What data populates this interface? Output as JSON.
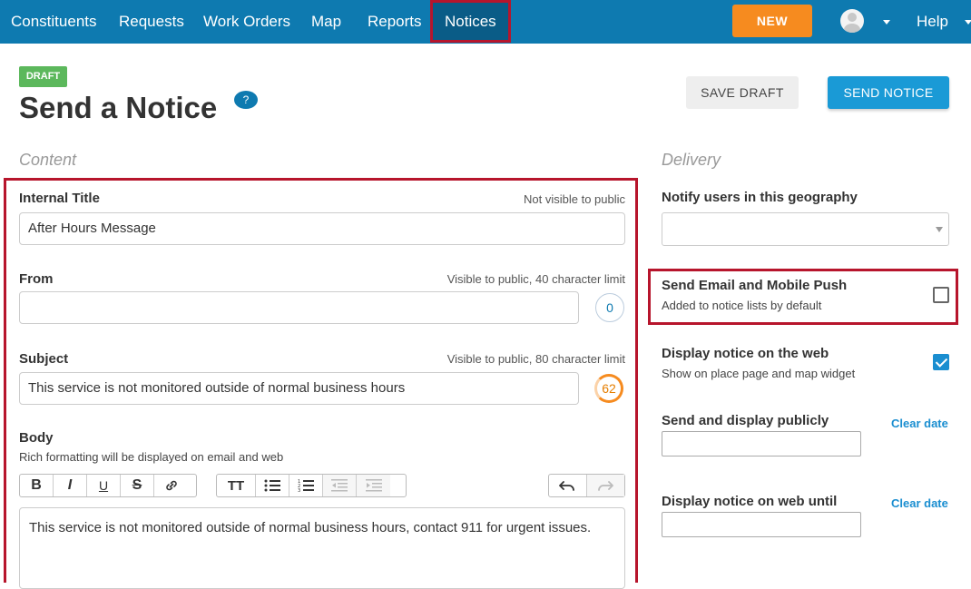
{
  "nav": {
    "items": [
      "Constituents",
      "Requests",
      "Work Orders",
      "Map",
      "Reports",
      "Notices"
    ],
    "new_label": "NEW",
    "help_label": "Help"
  },
  "header": {
    "badge": "DRAFT",
    "title": "Send a Notice",
    "help_icon": "?",
    "save_draft": "SAVE DRAFT",
    "send_notice": "SEND NOTICE"
  },
  "content": {
    "section_label": "Content",
    "internal_title": {
      "label": "Internal Title",
      "hint": "Not visible to public",
      "value": "After Hours Message"
    },
    "from": {
      "label": "From",
      "hint": "Visible to public, 40 character limit",
      "value": "",
      "counter": "0"
    },
    "subject": {
      "label": "Subject",
      "hint": "Visible to public, 80 character limit",
      "value": "This service is not monitored outside of normal business hours",
      "counter": "62"
    },
    "body": {
      "label": "Body",
      "sub": "Rich formatting will be displayed on email and web",
      "value": "This service is not monitored outside of normal business hours, contact 911 for urgent issues."
    },
    "toolbar_icons": [
      "bold-icon",
      "italic-icon",
      "underline-icon",
      "strikethrough-icon",
      "link-icon",
      "text-size-icon",
      "bullet-list-icon",
      "numbered-list-icon",
      "outdent-icon",
      "indent-icon",
      "undo-icon",
      "redo-icon"
    ]
  },
  "delivery": {
    "section_label": "Delivery",
    "geography_label": "Notify users in this geography",
    "email_push": {
      "title": "Send Email and Mobile Push",
      "sub": "Added to notice lists by default",
      "checked": false
    },
    "display_web": {
      "title": "Display notice on the web",
      "sub": "Show on place page and map widget",
      "checked": true
    },
    "send_display": {
      "label": "Send and display publicly",
      "clear": "Clear date",
      "value": ""
    },
    "display_until": {
      "label": "Display notice on web until",
      "clear": "Clear date",
      "value": ""
    }
  },
  "colors": {
    "nav_bg": "#0e7ab0",
    "accent_orange": "#f68b1f",
    "primary_blue": "#1a9ad6",
    "highlight_red": "#b7152c",
    "draft_green": "#5cb85c"
  }
}
